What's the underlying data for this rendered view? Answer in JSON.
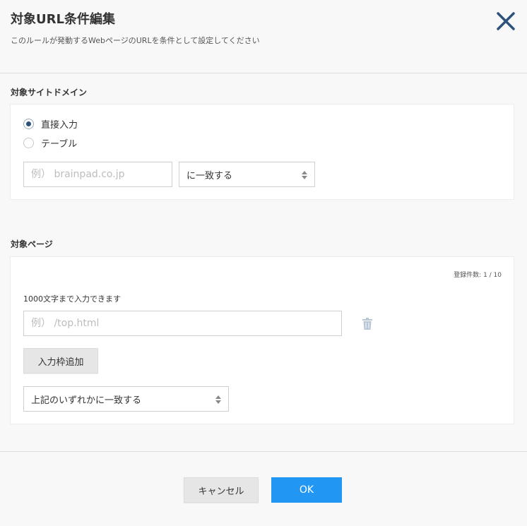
{
  "header": {
    "title": "対象URL条件編集",
    "subtitle": "このルールが発動するWebページのURLを条件として設定してください",
    "close_icon": "close-icon"
  },
  "domain_section": {
    "label": "対象サイトドメイン",
    "radio_options": [
      {
        "label": "直接入力",
        "checked": true
      },
      {
        "label": "テーブル",
        "checked": false
      }
    ],
    "domain_input": {
      "value": "",
      "placeholder": "例） brainpad.co.jp"
    },
    "match_select": {
      "value": "に一致する"
    }
  },
  "page_section": {
    "label": "対象ページ",
    "count_text": "登録件数: 1 / 10",
    "limit_text": "1000文字まで入力できます",
    "page_input": {
      "value": "",
      "placeholder": "例） /top.html"
    },
    "trash_icon": "trash-icon",
    "add_button": "入力枠追加",
    "match_select": {
      "value": "上記のいずれかに一致する"
    }
  },
  "footer": {
    "cancel": "キャンセル",
    "ok": "OK"
  },
  "colors": {
    "accent": "#2196f3",
    "close": "#2c527c",
    "radio_checked": "#2c527c"
  }
}
